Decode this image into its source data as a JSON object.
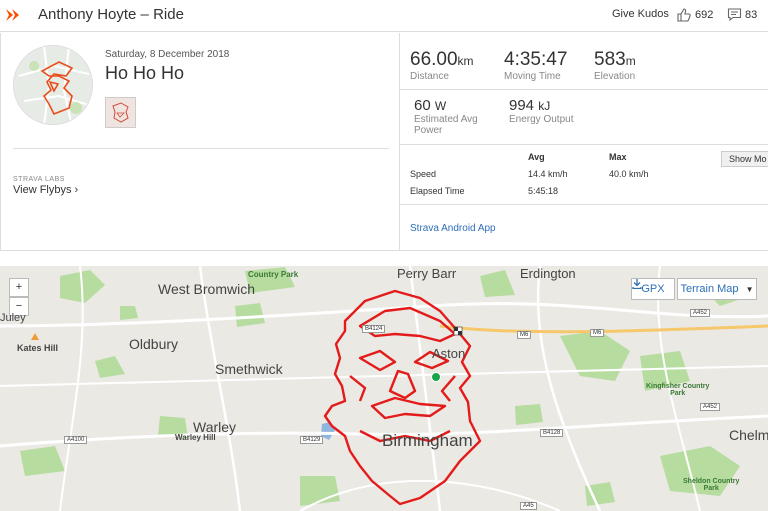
{
  "header": {
    "title": "Anthony Hoyte – Ride",
    "give_kudos": "Give Kudos",
    "kudos_count": "692",
    "comment_count": "83"
  },
  "activity": {
    "date": "Saturday, 8 December 2018",
    "name": "Ho Ho Ho",
    "labs_label": "STRAVA LABS",
    "flyby_link": "View Flybys ›"
  },
  "stats": {
    "distance": {
      "value": "66.00",
      "unit": "km",
      "label": "Distance"
    },
    "moving_time": {
      "value": "4:35:47",
      "label": "Moving Time"
    },
    "elevation": {
      "value": "583",
      "unit": "m",
      "label": "Elevation"
    },
    "power": {
      "value": "60",
      "unit": "W",
      "label_1": "Estimated Avg",
      "label_2": "Power"
    },
    "energy": {
      "value": "994",
      "unit": "kJ",
      "label": "Energy Output"
    }
  },
  "table": {
    "headers": {
      "avg": "Avg",
      "max": "Max"
    },
    "rows": [
      {
        "label": "Speed",
        "avg": "14.4 km/h",
        "max": "40.0 km/h"
      },
      {
        "label": "Elapsed Time",
        "avg": "5:45:18",
        "max": ""
      }
    ],
    "show_more": "Show Mo"
  },
  "app_link": "Strava Android App",
  "map": {
    "zoom_in": "+",
    "zoom_out": "−",
    "gpx": "GPX",
    "terrain": "Terrain Map",
    "places": {
      "west_bromwich": "West Bromwich",
      "oldbury": "Oldbury",
      "smethwick": "Smethwick",
      "warley": "Warley",
      "warley_hill": "Warley Hill",
      "kates_hill": "Kates Hill",
      "perry_barr": "Perry Barr",
      "erdington": "Erdington",
      "aston": "Aston",
      "birmingham": "Birmingham",
      "chelm": "Chelm",
      "country_park": "Country Park",
      "kingfisher_1": "Kingfisher Country",
      "kingfisher_2": "Park",
      "sheldon_1": "Sheldon Country",
      "sheldon_2": "Park",
      "dudley": "Juley"
    },
    "roads": {
      "b4124": "B4124",
      "a4100": "A4100",
      "b4129": "B4129",
      "b4128": "B4128",
      "m6": "M6",
      "a452": "A452",
      "a452b": "A452",
      "a45": "A45"
    }
  },
  "colors": {
    "brand": "#fc4c02",
    "route": "#e31b1b",
    "link": "#2e6fb7",
    "park": "#b6dca0"
  }
}
